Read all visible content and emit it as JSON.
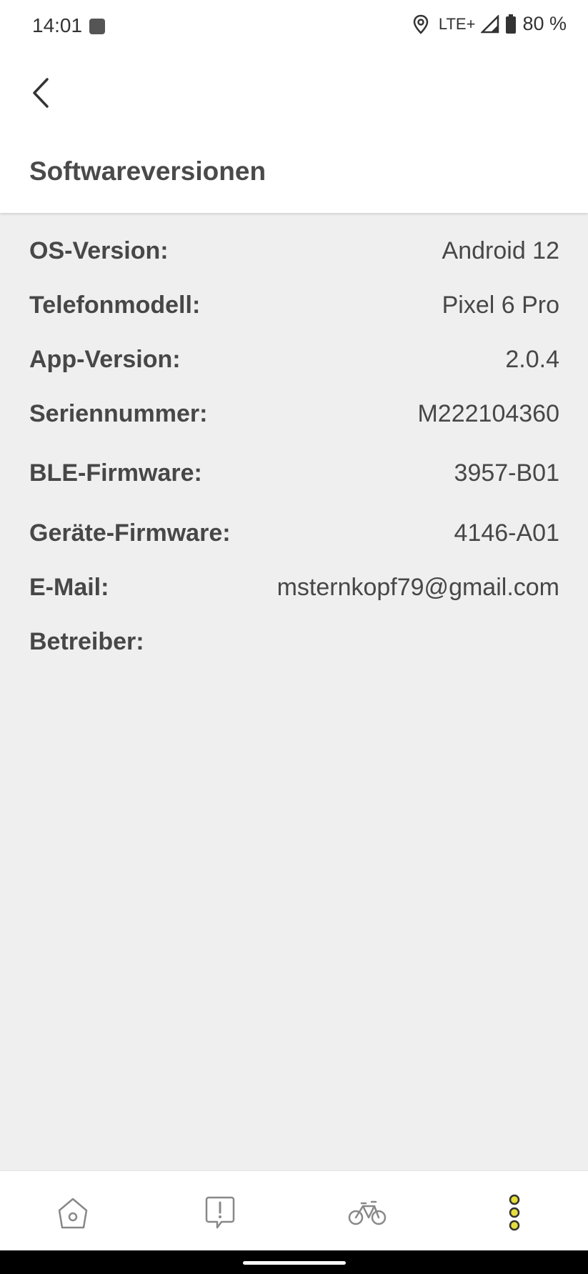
{
  "status_bar": {
    "time": "14:01",
    "network": "LTE+",
    "battery": "80 %",
    "icons": [
      "location-icon",
      "signal-icon",
      "battery-icon"
    ]
  },
  "header": {
    "title": "Softwareversionen",
    "back_icon": "chevron-left-icon"
  },
  "info": [
    {
      "label": "OS-Version:",
      "value": "Android 12"
    },
    {
      "label": "Telefonmodell:",
      "value": "Pixel 6 Pro"
    },
    {
      "label": "App-Version:",
      "value": "2.0.4"
    },
    {
      "label": "Seriennummer:",
      "value": "M222104360"
    },
    {
      "label": "BLE-Firmware:",
      "value": "3957-B01"
    },
    {
      "label": "Geräte-Firmware:",
      "value": "4146-A01"
    },
    {
      "label": "E-Mail:",
      "value": "msternkopf79@gmail.com"
    },
    {
      "label": "Betreiber:",
      "value": ""
    }
  ],
  "bottom_nav": {
    "items": [
      "home-icon",
      "alert-icon",
      "bike-icon",
      "more-icon"
    ],
    "accent_color": "#e6de3c"
  }
}
